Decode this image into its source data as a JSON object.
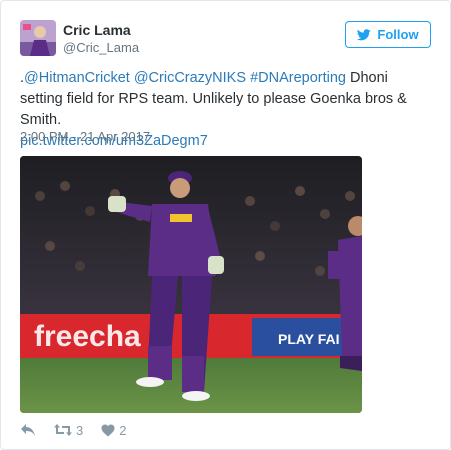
{
  "user": {
    "name": "Cric Lama",
    "handle": "@Cric_Lama"
  },
  "follow_button": {
    "label": "Follow"
  },
  "tweet": {
    "lead": ".",
    "mention_1": "@HitmanCricket",
    "mention_2": "@CricCrazyNIKS",
    "hashtag": "#DNAreporting",
    "body": " Dhoni setting field for RPS team. Unlikely to please Goenka bros & Smith.",
    "pic_link": "pic.twitter.com/um3ZaDegm7",
    "timestamp": "2:00 PM - 21 Apr 2017"
  },
  "actions": {
    "reply_icon": "reply-icon",
    "retweet_icon": "retweet-icon",
    "retweet_count": "3",
    "like_icon": "heart-icon",
    "like_count": "2"
  },
  "colors": {
    "link": "#2b7bb9",
    "follow_accent": "#1da1f2",
    "muted": "#66757f",
    "icon": "#8899a6"
  }
}
